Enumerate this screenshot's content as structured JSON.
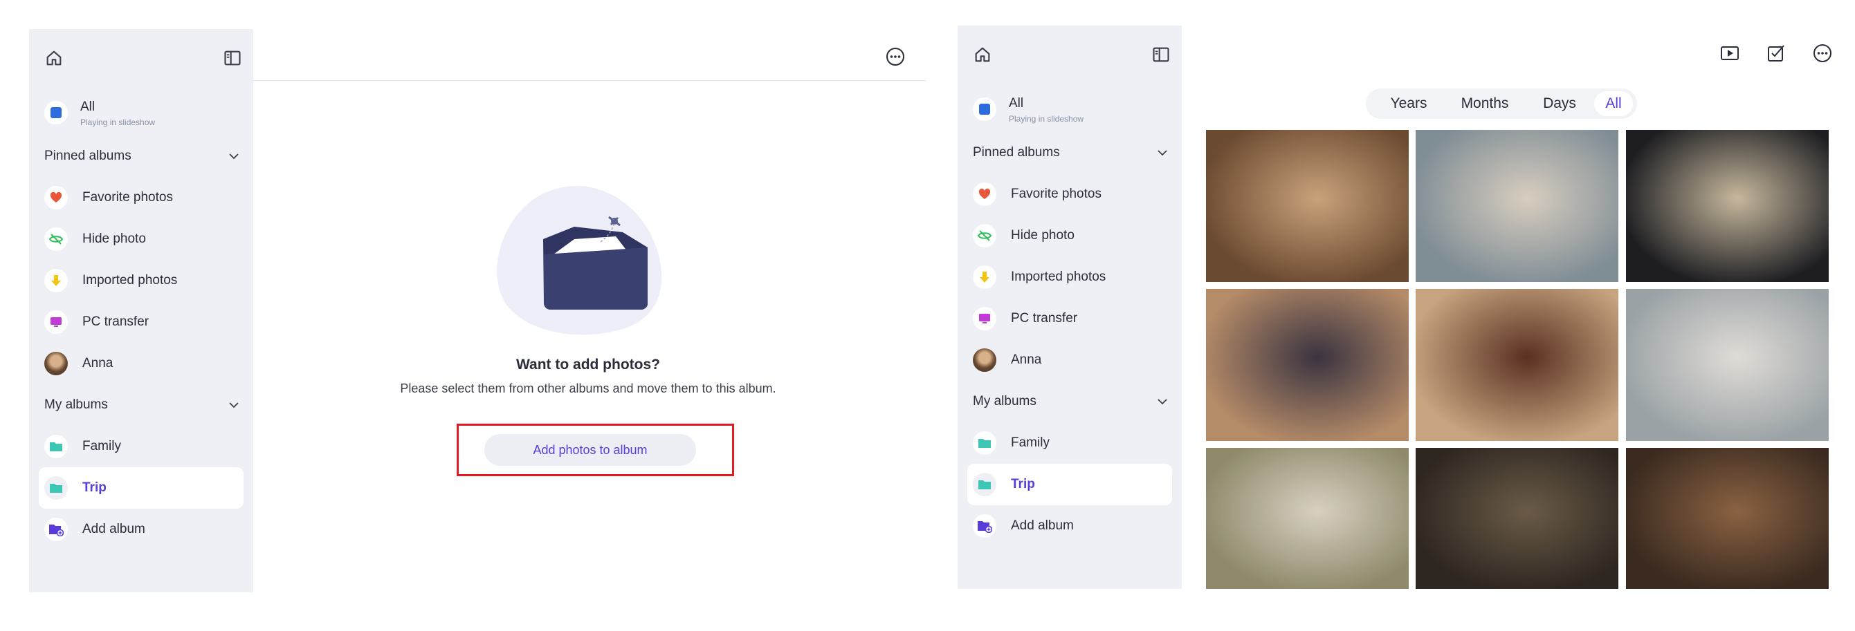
{
  "sidebar": {
    "all_label": "All",
    "all_sub": "Playing in slideshow",
    "pinned_label": "Pinned albums",
    "pinned_items": [
      {
        "label": "Favorite photos",
        "icon": "heart-icon",
        "color": "#e8573a"
      },
      {
        "label": "Hide photo",
        "icon": "eye-off-icon",
        "color": "#2fbf5a"
      },
      {
        "label": "Imported photos",
        "icon": "download-icon",
        "color": "#f2c414"
      },
      {
        "label": "PC transfer",
        "icon": "monitor-icon",
        "color": "#c13bd6"
      },
      {
        "label": "Anna",
        "icon": "avatar",
        "color": "#9a7a5a"
      }
    ],
    "my_albums_label": "My albums",
    "album_items": [
      {
        "label": "Family",
        "icon": "folder-icon",
        "color": "#3cc7b4"
      },
      {
        "label": "Trip",
        "icon": "folder-icon",
        "color": "#3cc7b4"
      },
      {
        "label": "Add album",
        "icon": "add-folder-icon",
        "color": "#5a3dd8"
      }
    ]
  },
  "empty_state": {
    "title": "Want to add photos?",
    "subtitle": "Please select them from other albums and move them to this album.",
    "button": "Add photos to album"
  },
  "view_tabs": [
    "Years",
    "Months",
    "Days",
    "All"
  ],
  "selected_tab": "All",
  "photos": [
    {
      "name": "photo-1",
      "c1": "#6b4a32",
      "c2": "#c9a27a"
    },
    {
      "name": "photo-2",
      "c1": "#7f8d95",
      "c2": "#d8cdbf"
    },
    {
      "name": "photo-3",
      "c1": "#1e1e22",
      "c2": "#c7b89d"
    },
    {
      "name": "photo-4",
      "c1": "#b58b68",
      "c2": "#3a3340"
    },
    {
      "name": "photo-5",
      "c1": "#c6a47f",
      "c2": "#5a3022"
    },
    {
      "name": "photo-6",
      "c1": "#9aa2a6",
      "c2": "#e0dcd6"
    },
    {
      "name": "photo-7",
      "c1": "#8e8a6a",
      "c2": "#d7d0c2"
    },
    {
      "name": "photo-8",
      "c1": "#2e2620",
      "c2": "#6a5b48"
    },
    {
      "name": "photo-9",
      "c1": "#3a2a20",
      "c2": "#8a6242"
    }
  ]
}
